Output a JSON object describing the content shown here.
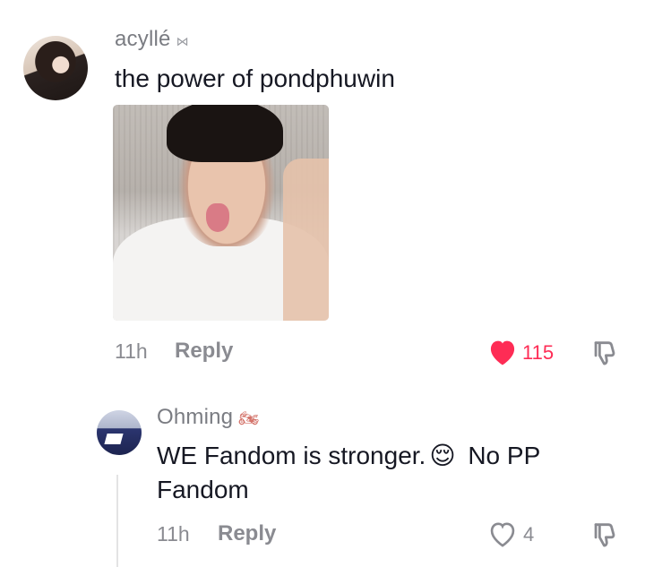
{
  "comment": {
    "username": "acyllé",
    "badge": "⋈",
    "text": "the power of pondphuwin",
    "time": "11h",
    "reply_label": "Reply",
    "likes": "115",
    "liked": true
  },
  "reply": {
    "username": "Ohming",
    "badge": "🏍",
    "text_line1": "WE Fandom is stronger.",
    "emoji": "😌",
    "text_line1_end": " No PP",
    "text_line2": "Fandom",
    "time": "11h",
    "reply_label": "Reply",
    "likes": "4",
    "liked": false
  },
  "colors": {
    "like_red": "#fe2c55",
    "muted_gray": "#8a8b91",
    "text_dark": "#161823"
  },
  "icons": {
    "heart": "heart-icon",
    "dislike": "thumbs-down-icon"
  }
}
